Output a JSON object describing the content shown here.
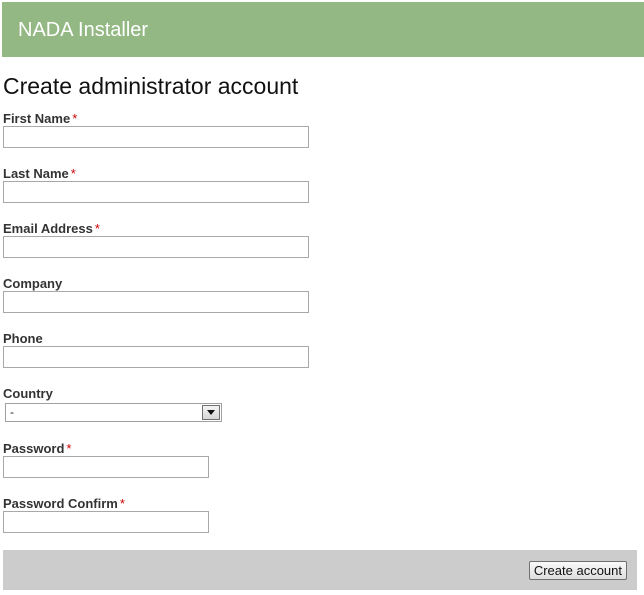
{
  "header": {
    "title": "NADA Installer"
  },
  "page": {
    "title": "Create administrator account"
  },
  "required_marker": "*",
  "fields": {
    "first_name": {
      "label": "First Name",
      "value": ""
    },
    "last_name": {
      "label": "Last Name",
      "value": ""
    },
    "email": {
      "label": "Email Address",
      "value": ""
    },
    "company": {
      "label": "Company",
      "value": ""
    },
    "phone": {
      "label": "Phone",
      "value": ""
    },
    "country": {
      "label": "Country",
      "selected": "-"
    },
    "password": {
      "label": "Password",
      "value": ""
    },
    "password_confirm": {
      "label": "Password Confirm",
      "value": ""
    }
  },
  "footer": {
    "submit_label": "Create account"
  },
  "colors": {
    "header_bg": "#93b883",
    "footer_bg": "#cccccc",
    "required": "#cc0000"
  }
}
